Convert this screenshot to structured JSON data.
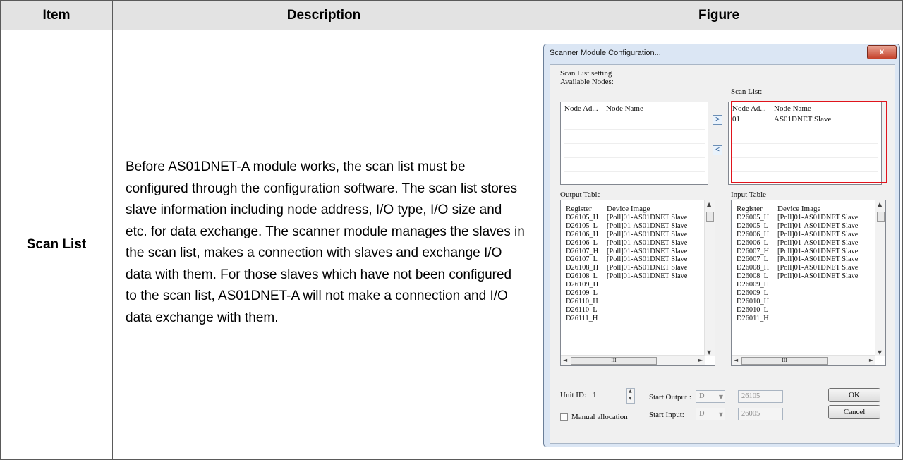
{
  "table": {
    "headers": {
      "item": "Item",
      "description": "Description",
      "figure": "Figure"
    },
    "row": {
      "item": "Scan List",
      "description": "Before AS01DNET-A module works, the scan list must be configured through the configuration software. The scan list stores slave information including node address, I/O type, I/O size and etc. for data exchange. The scanner module manages the slaves in the scan list, makes a connection with slaves and exchange I/O data with them. For those slaves which have not been configured to the scan list, AS01DNET-A will not make a connection and I/O data exchange with them."
    }
  },
  "dialog": {
    "title": "Scanner Module Configuration...",
    "close_label": "x",
    "group_label": "Scan List setting",
    "available_nodes": {
      "label": "Available Nodes:",
      "col_address": "Node Ad...",
      "col_name": "Node Name"
    },
    "add_button": ">",
    "remove_button": "<",
    "scan_list": {
      "label": "Scan List:",
      "col_address": "Node Ad...",
      "col_name": "Node Name",
      "rows": [
        {
          "address": "01",
          "name": "AS01DNET Slave"
        }
      ]
    },
    "output_table": {
      "label": "Output Table",
      "col_register": "Register",
      "col_image": "Device Image",
      "rows": [
        [
          "D26105_H",
          "[Poll]01-AS01DNET Slave"
        ],
        [
          "D26105_L",
          "[Poll]01-AS01DNET Slave"
        ],
        [
          "D26106_H",
          "[Poll]01-AS01DNET Slave"
        ],
        [
          "D26106_L",
          "[Poll]01-AS01DNET Slave"
        ],
        [
          "D26107_H",
          "[Poll]01-AS01DNET Slave"
        ],
        [
          "D26107_L",
          "[Poll]01-AS01DNET Slave"
        ],
        [
          "D26108_H",
          "[Poll]01-AS01DNET Slave"
        ],
        [
          "D26108_L",
          "[Poll]01-AS01DNET Slave"
        ],
        [
          "D26109_H",
          ""
        ],
        [
          "D26109_L",
          ""
        ],
        [
          "D26110_H",
          ""
        ],
        [
          "D26110_L",
          ""
        ],
        [
          "D26111_H",
          ""
        ]
      ]
    },
    "input_table": {
      "label": "Input Table",
      "col_register": "Register",
      "col_image": "Device Image",
      "rows": [
        [
          "D26005_H",
          "[Poll]01-AS01DNET Slave"
        ],
        [
          "D26005_L",
          "[Poll]01-AS01DNET Slave"
        ],
        [
          "D26006_H",
          "[Poll]01-AS01DNET Slave"
        ],
        [
          "D26006_L",
          "[Poll]01-AS01DNET Slave"
        ],
        [
          "D26007_H",
          "[Poll]01-AS01DNET Slave"
        ],
        [
          "D26007_L",
          "[Poll]01-AS01DNET Slave"
        ],
        [
          "D26008_H",
          "[Poll]01-AS01DNET Slave"
        ],
        [
          "D26008_L",
          "[Poll]01-AS01DNET Slave"
        ],
        [
          "D26009_H",
          ""
        ],
        [
          "D26009_L",
          ""
        ],
        [
          "D26010_H",
          ""
        ],
        [
          "D26010_L",
          ""
        ],
        [
          "D26011_H",
          ""
        ]
      ]
    },
    "scroll_grip": "III",
    "unit_id": {
      "label": "Unit ID:",
      "value": "1"
    },
    "start_output": {
      "label": "Start Output :",
      "device": "D",
      "value": "26105"
    },
    "start_input": {
      "label": "Start Input:",
      "device": "D",
      "value": "26005"
    },
    "manual_allocation": {
      "label": "Manual allocation",
      "checked": false
    },
    "ok_button": "OK",
    "cancel_button": "Cancel",
    "highlight_color": "#e0141c"
  }
}
